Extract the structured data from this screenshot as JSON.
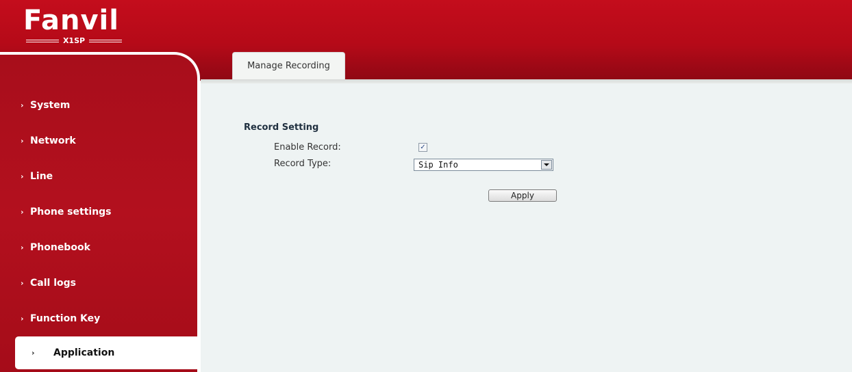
{
  "brand": {
    "logo_text": "Fanvil",
    "model": "X1SP"
  },
  "sidebar": {
    "items": [
      {
        "label": "System"
      },
      {
        "label": "Network"
      },
      {
        "label": "Line"
      },
      {
        "label": "Phone settings"
      },
      {
        "label": "Phonebook"
      },
      {
        "label": "Call logs"
      },
      {
        "label": "Function Key"
      },
      {
        "label": "Application"
      }
    ],
    "active": "Application"
  },
  "tabs": [
    {
      "label": "Manage Recording"
    }
  ],
  "record_setting": {
    "section_title": "Record Setting",
    "enable_record_label": "Enable Record:",
    "enable_record_checked": true,
    "record_type_label": "Record Type:",
    "record_type_value": "Sip Info"
  },
  "actions": {
    "apply_label": "Apply"
  },
  "colors": {
    "brand_red": "#b50a18",
    "content_bg": "#eef3f3"
  }
}
